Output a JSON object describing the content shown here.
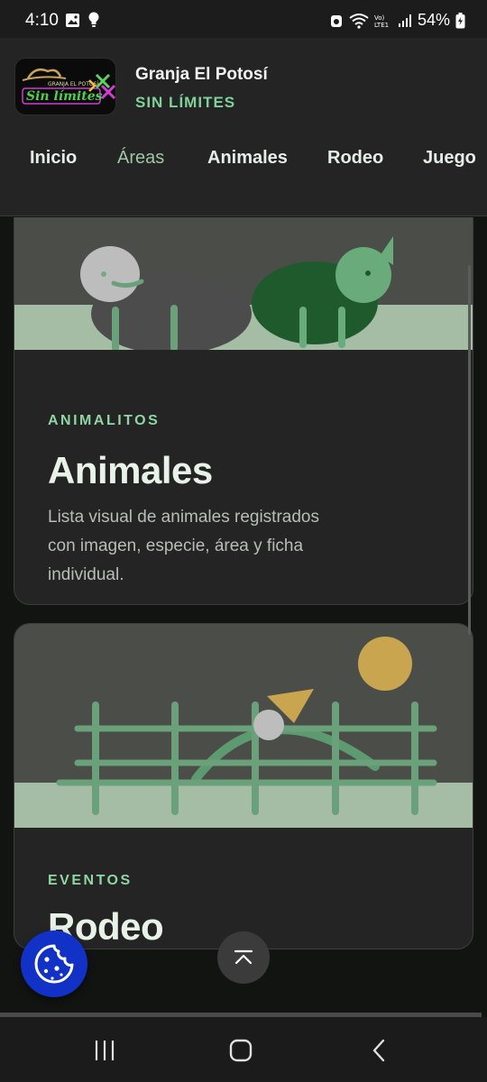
{
  "status": {
    "time": "4:10",
    "battery": "54%"
  },
  "header": {
    "title": "Granja El Potosí",
    "subtitle": "SIN LÍMITES",
    "logo_text_top": "GRANJA EL POTOSÍ",
    "logo_text_main": "Sin límites"
  },
  "nav": {
    "items": [
      {
        "label": "Inicio",
        "active": false
      },
      {
        "label": "Áreas",
        "active": true
      },
      {
        "label": "Animales",
        "active": false
      },
      {
        "label": "Rodeo",
        "active": false
      },
      {
        "label": "Juego",
        "active": false
      }
    ]
  },
  "cards": [
    {
      "tag": "ANIMALITOS",
      "title": "Animales",
      "description": "Lista visual de animales registrados con imagen, especie, área y ficha individual."
    },
    {
      "tag": "EVENTOS",
      "title": "Rodeo"
    }
  ],
  "colors": {
    "accent": "#7fd39a",
    "cookie": "#1232c7",
    "sun": "#c9a550"
  },
  "icons": {
    "cookie": "cookie-icon",
    "back_to_top": "chevron-up-icon"
  }
}
